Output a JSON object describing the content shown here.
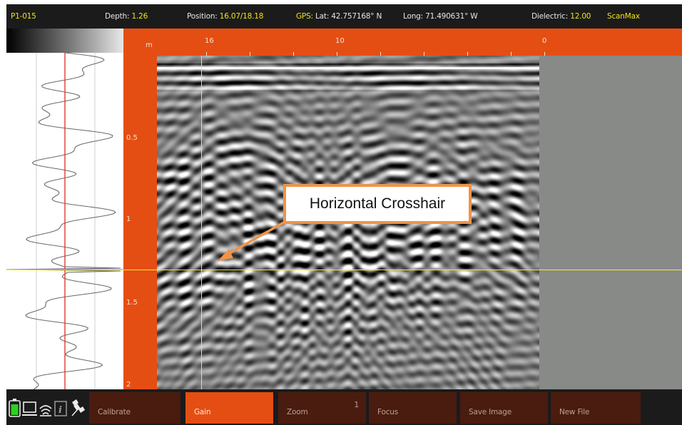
{
  "status": {
    "file": "P1-015",
    "depth_label": "Depth:",
    "depth_value": "1.26",
    "position_label": "Position:",
    "position_value": "16.07/18.18",
    "gps_label": "GPS:",
    "lat_label": "Lat:",
    "lat_value": "42.757168° N",
    "long_label": "Long:",
    "long_value": "71.490631° W",
    "dielectric_label": "Dielectric:",
    "dielectric_value": "12.00",
    "mode": "ScanMax"
  },
  "depth_ruler": {
    "unit": "m",
    "labels": [
      "0.5",
      "1",
      "1.5",
      "2"
    ]
  },
  "distance_ruler": {
    "labels": [
      "16",
      "10",
      "0"
    ]
  },
  "callout": {
    "text": "Horizontal Crosshair"
  },
  "toolbar": {
    "buttons": [
      {
        "label": "Calibrate",
        "active": false
      },
      {
        "label": "Gain",
        "active": true
      },
      {
        "label": "Zoom",
        "value": "1",
        "active": false
      },
      {
        "label": "Focus",
        "active": false
      },
      {
        "label": "Save Image",
        "active": false
      },
      {
        "label": "New File",
        "active": false
      }
    ]
  },
  "icons": [
    "battery-icon",
    "display-icon",
    "wireless-icon",
    "info-icon",
    "satellite-icon"
  ],
  "colors": {
    "accent": "#e54e12",
    "highlight": "#f2e21f",
    "crosshair": "#f2ec2b",
    "callout_border": "#f09348",
    "button_dark": "#4a1c10"
  }
}
